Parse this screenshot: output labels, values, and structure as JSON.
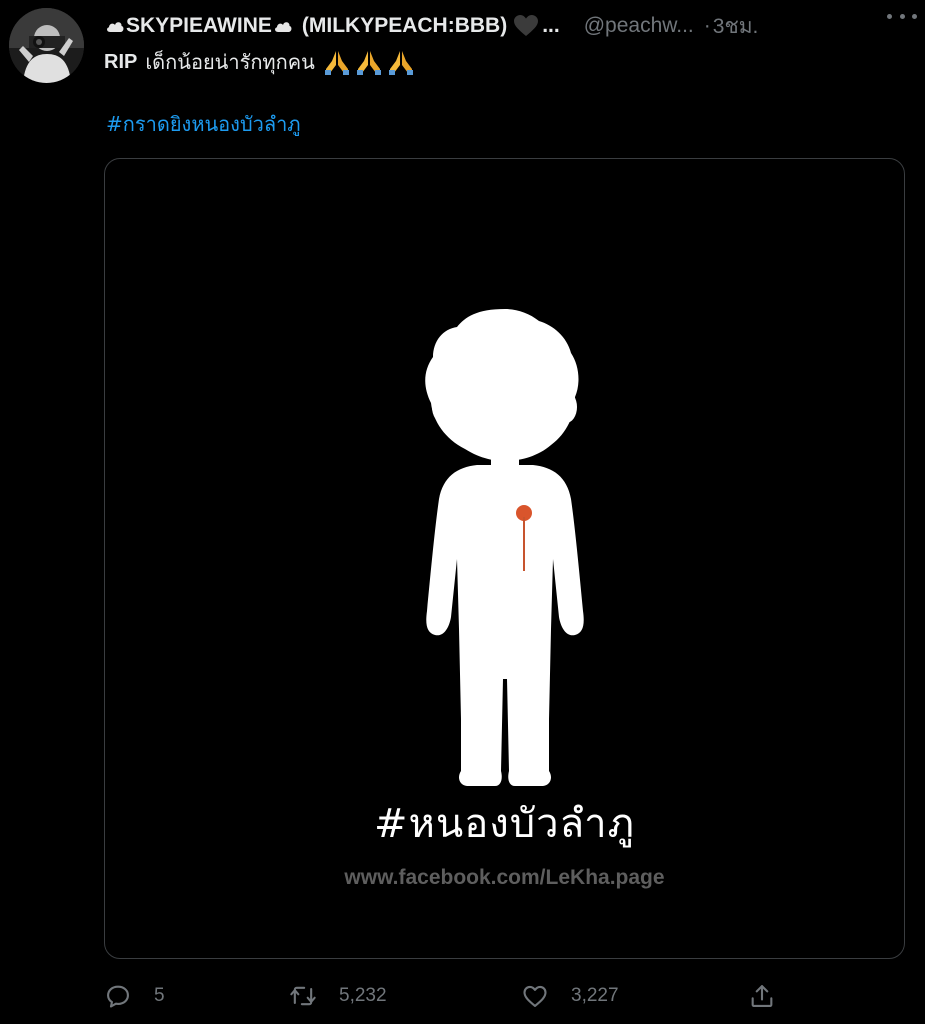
{
  "tweet": {
    "author": {
      "display_name": "SKYPIEAWINE",
      "display_name_suffix": "(MILKYPEACH:BBB)",
      "name_ellipsis": "...",
      "handle": "@peachw...",
      "separator": "·",
      "time": "3ชม."
    },
    "text": {
      "lead": "RIP",
      "body": "เด็กน้อยน่ารักทุกคน"
    },
    "hashtag": "#กราดยิงหนองบัวลำภู",
    "media": {
      "hashtag_overlay": "#หนองบัวลำภู",
      "watermark": "www.facebook.com/LeKha.page"
    },
    "actions": {
      "replies": "5",
      "retweets": "5,232",
      "likes": "3,227"
    }
  },
  "colors": {
    "background": "#000000",
    "text": "#e7e9ea",
    "muted": "#71767b",
    "link": "#1d9bf0",
    "wound": "#d9552c"
  },
  "icons": {
    "header": [
      "cloud-icon",
      "cloud-icon",
      "black-heart-icon",
      "more-icon"
    ],
    "text": [
      "folded-hands-icon",
      "folded-hands-icon",
      "folded-hands-icon"
    ],
    "actions": [
      "reply-icon",
      "retweet-icon",
      "like-icon",
      "share-icon"
    ]
  }
}
